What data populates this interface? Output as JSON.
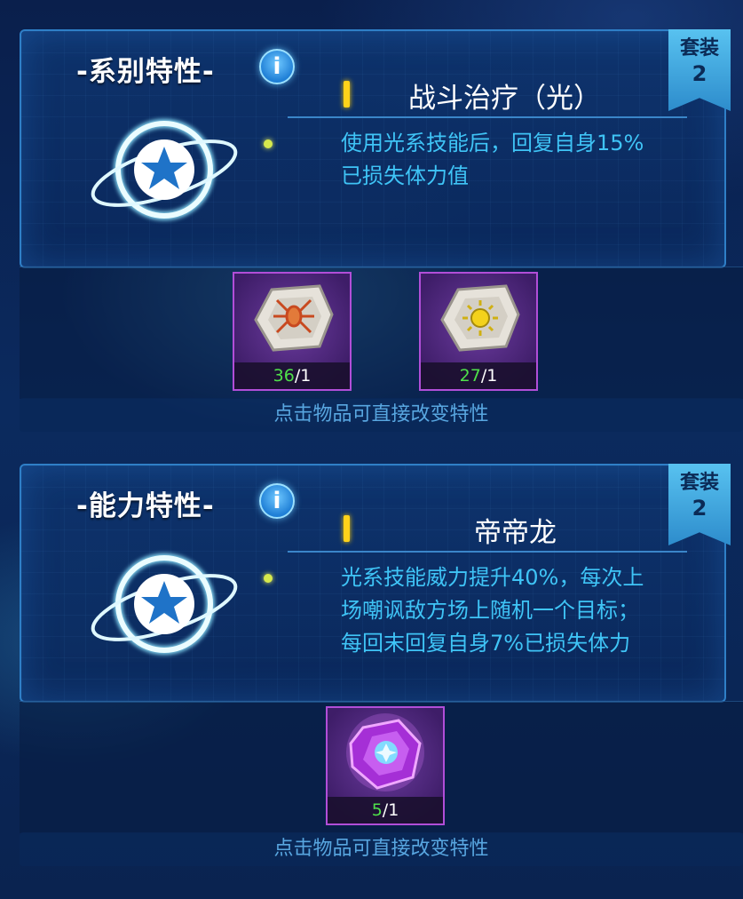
{
  "sections": [
    {
      "heading": "-系别特性-",
      "info_icon": "info-icon",
      "badge": {
        "label": "套装",
        "count": "2"
      },
      "trait_name": "战斗治疗（光）",
      "description_lines": [
        "使用光系技能后，回复自身15%",
        "已损失体力值"
      ],
      "items": [
        {
          "icon": "spider-rune-stone-icon",
          "have": "36",
          "need": "/1"
        },
        {
          "icon": "sun-rune-stone-icon",
          "have": "27",
          "need": "/1"
        }
      ],
      "hint": "点击物品可直接改变特性"
    },
    {
      "heading": "-能力特性-",
      "info_icon": "info-icon",
      "badge": {
        "label": "套装",
        "count": "2"
      },
      "trait_name": "帝帝龙",
      "description_lines": [
        "光系技能威力提升40%，每次上",
        "场嘲讽敌方场上随机一个目标；",
        "每回末回复自身7%已损失体力"
      ],
      "items": [
        {
          "icon": "purple-crystal-gem-icon",
          "have": "5",
          "need": "/1"
        }
      ],
      "hint": "点击物品可直接改变特性"
    }
  ],
  "colors": {
    "accent_blue": "#3fc4f6",
    "count_green": "#4fe04a",
    "badge": "#58c2f0",
    "item_border": "#b14ed8"
  }
}
